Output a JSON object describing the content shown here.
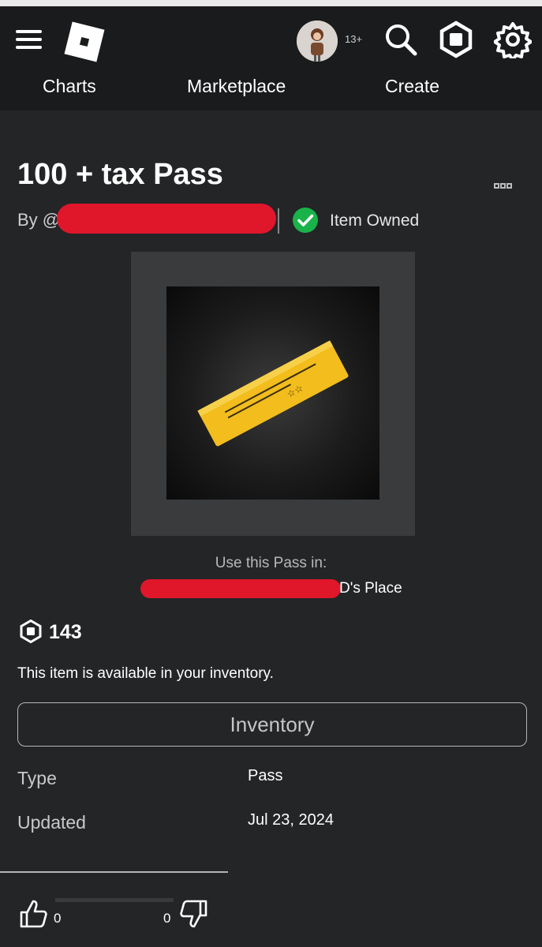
{
  "header": {
    "age_badge": "13+",
    "nav": [
      "Charts",
      "Marketplace",
      "Create"
    ],
    "icons": [
      "menu-icon",
      "roblox-logo",
      "avatar",
      "search-icon",
      "robux-icon",
      "gear-icon"
    ]
  },
  "item": {
    "title": "100 + tax Pass",
    "by_prefix": "By @",
    "owned_label": "Item Owned",
    "use_label": "Use this Pass in:",
    "place_suffix": "D's Place",
    "price": "143",
    "availability": "This item is available in your inventory.",
    "inventory_button": "Inventory"
  },
  "details": {
    "type_label": "Type",
    "type_value": "Pass",
    "updated_label": "Updated",
    "updated_value": "Jul 23, 2024"
  },
  "votes": {
    "up": "0",
    "down": "0"
  },
  "colors": {
    "background": "#232527",
    "topbar": "#191b1d",
    "owned_green": "#19b34a",
    "ticket_gold": "#f2bd1d",
    "redaction": "#e0162b"
  }
}
